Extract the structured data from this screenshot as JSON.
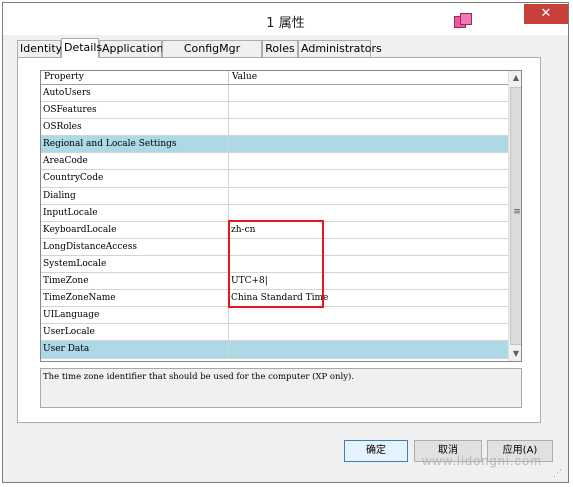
{
  "window": {
    "title": "1 属性",
    "close_label": "✕"
  },
  "tabs": [
    {
      "label": "Identity",
      "active": false
    },
    {
      "label": "Details",
      "active": true
    },
    {
      "label": "Applications",
      "active": false
    },
    {
      "label": "ConfigMgr Packages",
      "active": false
    },
    {
      "label": "Roles",
      "active": false
    },
    {
      "label": "Administrators",
      "active": false
    }
  ],
  "grid": {
    "columns": {
      "property": "Property",
      "value": "Value"
    },
    "rows": [
      {
        "property": "AutoUsers",
        "value": "",
        "section": false
      },
      {
        "property": "OSFeatures",
        "value": "",
        "section": false
      },
      {
        "property": "OSRoles",
        "value": "",
        "section": false
      },
      {
        "property": "Regional and Locale Settings",
        "value": "",
        "section": true
      },
      {
        "property": "AreaCode",
        "value": "",
        "section": false
      },
      {
        "property": "CountryCode",
        "value": "",
        "section": false
      },
      {
        "property": "Dialing",
        "value": "",
        "section": false
      },
      {
        "property": "InputLocale",
        "value": "",
        "section": false
      },
      {
        "property": "KeyboardLocale",
        "value": "zh-cn",
        "section": false
      },
      {
        "property": "LongDistanceAccess",
        "value": "",
        "section": false
      },
      {
        "property": "SystemLocale",
        "value": "",
        "section": false
      },
      {
        "property": "TimeZone",
        "value": "UTC+8|",
        "section": false
      },
      {
        "property": "TimeZoneName",
        "value": "China Standard Time",
        "section": false
      },
      {
        "property": "UILanguage",
        "value": "",
        "section": false
      },
      {
        "property": "UserLocale",
        "value": "",
        "section": false
      },
      {
        "property": "User Data",
        "value": "",
        "section": true
      }
    ]
  },
  "scrollbar": {
    "up": "▲",
    "down": "▼",
    "grip": "≡"
  },
  "description": "The time zone identifier that should be used for the computer (XP only).",
  "buttons": {
    "ok": "确定",
    "cancel": "取消",
    "apply": "应用(A)"
  },
  "watermark": "www.lidongni.com",
  "colors": {
    "section_bg": "#add8e6",
    "highlight": "#e8161b",
    "close_bg": "#c7413a"
  }
}
